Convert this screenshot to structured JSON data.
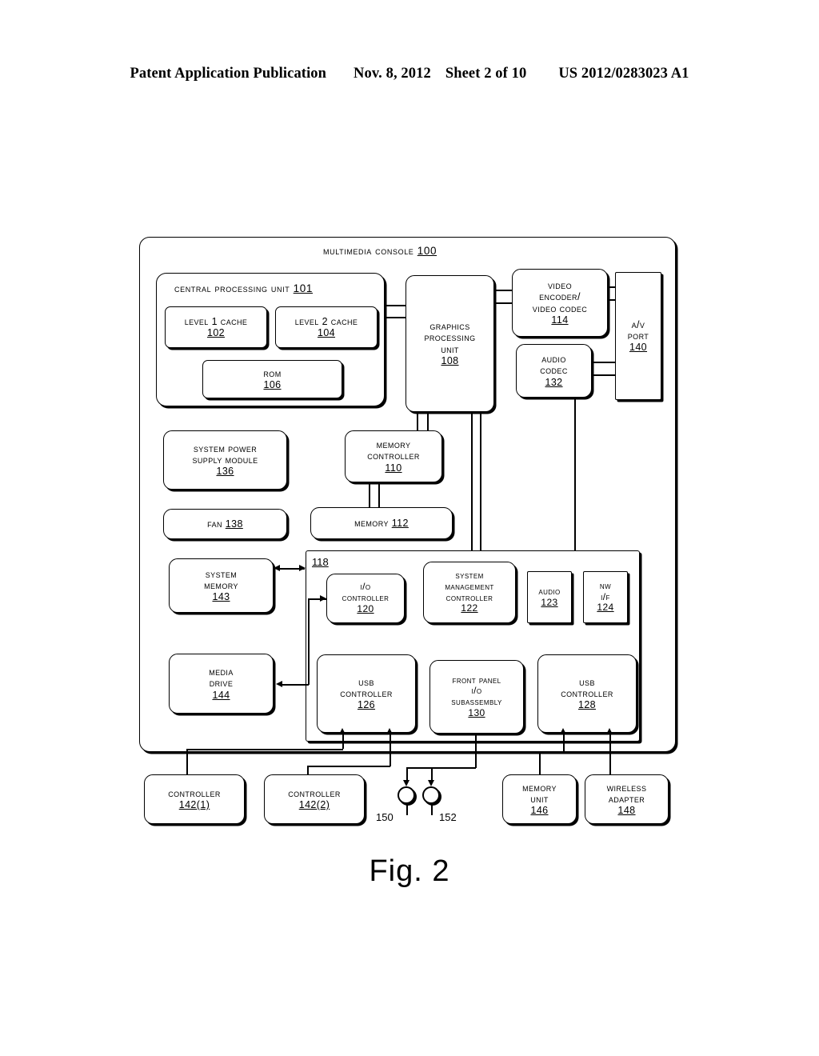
{
  "header": {
    "publication": "Patent Application Publication",
    "date": "Nov. 8, 2012",
    "sheet": "Sheet 2 of 10",
    "number": "US 2012/0283023 A1"
  },
  "figure": {
    "caption": "Fig. 2"
  },
  "diagram": {
    "console": {
      "title_text": "Multimedia Console ",
      "title_num": "100"
    },
    "cpu": {
      "title_text": "Central Processing Unit ",
      "title_num": "101",
      "l1": {
        "line1": "Level 1 Cache",
        "num": "102"
      },
      "l2": {
        "line1": "Level 2 Cache",
        "num": "104"
      },
      "rom": {
        "line1": "ROM",
        "num": "106"
      }
    },
    "gpu": {
      "line1": "Graphics",
      "line2": "Processing",
      "line3": "Unit",
      "num": "108"
    },
    "video_codec": {
      "line1": "Video",
      "line2": "Encoder/",
      "line3": "Video Codec",
      "num": "114"
    },
    "audio_codec": {
      "line1": "Audio",
      "line2": "Codec",
      "num": "132"
    },
    "av_port": {
      "line1": "A/V",
      "line2": "Port",
      "num": "140"
    },
    "power_supply": {
      "line1": "System Power",
      "line2": "Supply Module",
      "num": "136"
    },
    "fan": {
      "line1": "Fan ",
      "num": "138"
    },
    "memory_controller": {
      "line1": "Memory",
      "line2": "Controller",
      "num": "110"
    },
    "memory": {
      "line1": "Memory ",
      "num": "112"
    },
    "system_memory": {
      "line1": "System",
      "line2": "Memory",
      "num": "143"
    },
    "media_drive": {
      "line1": "Media",
      "line2": "Drive",
      "num": "144"
    },
    "io_container": {
      "label_num": "118"
    },
    "io_controller": {
      "line1": "I/O",
      "line2": "Controller",
      "num": "120"
    },
    "system_mgmt_controller": {
      "line1": "System",
      "line2": "Management",
      "line3": "Controller",
      "num": "122"
    },
    "audio": {
      "line1": "Audio",
      "num": "123"
    },
    "nw_if": {
      "line1": "NW",
      "line2": "I/F",
      "num": "124"
    },
    "usb_controller_126": {
      "line1": "USB",
      "line2": "Controller",
      "num": "126"
    },
    "front_panel": {
      "line1": "Front Panel",
      "line2": "I/O",
      "line3": "Subassembly",
      "num": "130"
    },
    "usb_controller_128": {
      "line1": "USB",
      "line2": "Controller",
      "num": "128"
    },
    "controller_1": {
      "line1": "Controller",
      "num": "142(1)"
    },
    "controller_2": {
      "line1": "Controller",
      "num": "142(2)"
    },
    "node_150": "150",
    "node_152": "152",
    "memory_unit": {
      "line1": "Memory",
      "line2": "Unit",
      "num": "146"
    },
    "wireless_adapter": {
      "line1": "Wireless",
      "line2": "Adapter",
      "num": "148"
    }
  }
}
